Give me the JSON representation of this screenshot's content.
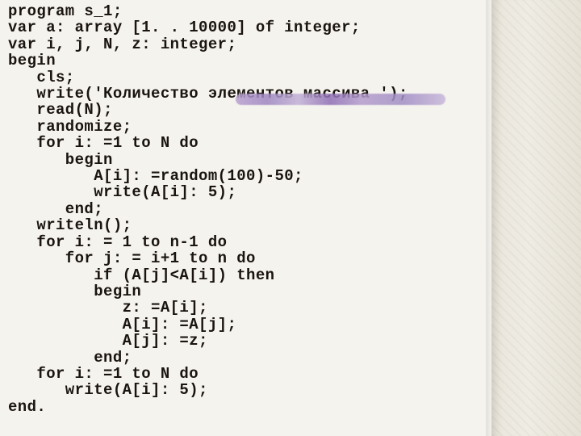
{
  "code": {
    "lines": [
      "program s_1;",
      "var a: array [1. . 10000] of integer;",
      "var i, j, N, z: integer;",
      "begin",
      "   cls;",
      "   write('Количество элементов массива ');",
      "   read(N);",
      "   randomize;",
      "   for i: =1 to N do",
      "      begin",
      "         A[i]: =random(100)-50;",
      "         write(A[i]: 5);",
      "      end;",
      "   writeln();",
      "   for i: = 1 to n-1 do",
      "      for j: = i+1 to n do",
      "         if (A[j]<A[i]) then",
      "         begin",
      "            z: =A[i];",
      "            A[i]: =A[j];",
      "            A[j]: =z;",
      "         end;",
      "   for i: =1 to N do",
      "      write(A[i]: 5);",
      "end."
    ]
  }
}
